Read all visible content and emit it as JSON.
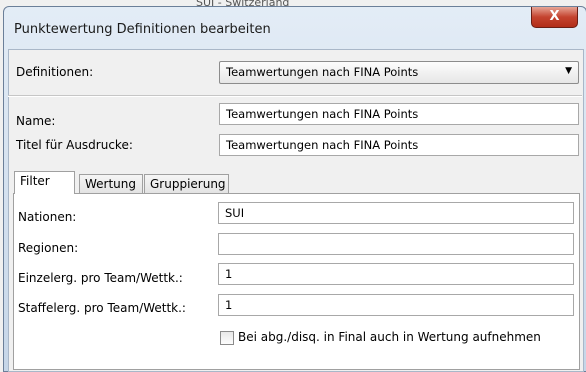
{
  "background_text": "SUI - Switzerland",
  "window": {
    "title": "Punktewertung Definitionen bearbeiten",
    "close_label": "X"
  },
  "definitions": {
    "label": "Definitionen:",
    "selected": "Teamwertungen nach FINA Points"
  },
  "name": {
    "label": "Name:",
    "value": "Teamwertungen nach FINA Points"
  },
  "print_title": {
    "label": "Titel für Ausdrucke:",
    "value": "Teamwertungen nach FINA Points"
  },
  "tabs": [
    {
      "label": "Filter"
    },
    {
      "label": "Wertung"
    },
    {
      "label": "Gruppierung"
    }
  ],
  "filter": {
    "nations": {
      "label": "Nationen:",
      "value": "SUI"
    },
    "regions": {
      "label": "Regionen:",
      "value": ""
    },
    "individual": {
      "label": "Einzelerg. pro Team/Wettk.:",
      "value": "1"
    },
    "relay": {
      "label": "Staffelerg. pro Team/Wettk.:",
      "value": "1"
    },
    "checkbox": {
      "label": "Bei abg./disq. in Final auch in Wertung aufnehmen",
      "checked": false
    }
  }
}
